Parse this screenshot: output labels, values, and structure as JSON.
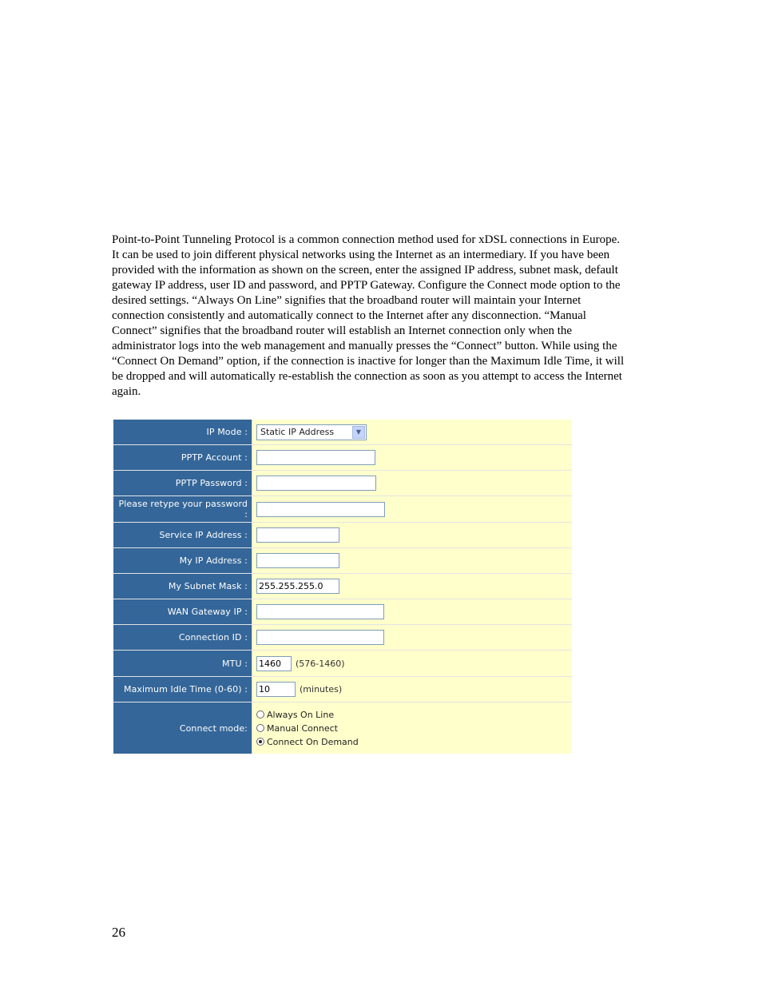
{
  "paragraph_lines": [
    "Point-to-Point Tunneling Protocol is a common connection method used for xDSL connections in Europe.",
    "It can be used to join different physical networks using the Internet as an intermediary. If you have been",
    "provided with the information as shown on the screen, enter the assigned IP address, subnet mask, default",
    "gateway IP address, user ID and password, and PPTP Gateway. Configure the Connect mode option to the",
    "desired settings. “Always On Line” signifies that the broadband router will maintain your Internet",
    "connection consistently and automatically connect to the Internet after any disconnection. “Manual",
    "Connect” signifies that the broadband router will establish an Internet connection only when the",
    "administrator logs into the web management and manually presses the “Connect” button. While using the",
    "“Connect On Demand” option, if the connection is inactive for longer than the Maximum Idle Time, it will",
    "be dropped and will automatically re-establish the connection as soon as you attempt to access the Internet",
    "again."
  ],
  "form": {
    "ip_mode": {
      "label": "IP Mode :",
      "value": "Static IP Address"
    },
    "pptp_account": {
      "label": "PPTP Account :",
      "value": ""
    },
    "pptp_password": {
      "label": "PPTP Password :",
      "value": ""
    },
    "retype_password": {
      "label": "Please retype your password :",
      "value": ""
    },
    "service_ip": {
      "label": "Service IP Address :",
      "value": ""
    },
    "my_ip": {
      "label": "My IP Address :",
      "value": ""
    },
    "subnet_mask": {
      "label": "My Subnet Mask :",
      "value": "255.255.255.0"
    },
    "wan_gateway": {
      "label": "WAN Gateway IP :",
      "value": ""
    },
    "connection_id": {
      "label": "Connection ID :",
      "value": ""
    },
    "mtu": {
      "label": "MTU :",
      "value": "1460",
      "hint": "(576-1460)"
    },
    "idle_time": {
      "label": "Maximum Idle Time (0-60) :",
      "value": "10",
      "hint": "(minutes)"
    },
    "connect_mode": {
      "label": "Connect mode:",
      "options": [
        "Always On Line",
        "Manual Connect",
        "Connect On Demand"
      ],
      "selected": "Connect On Demand"
    }
  },
  "colors": {
    "label_bg": "#346699",
    "value_bg": "#ffffcc"
  },
  "page_number": "26"
}
